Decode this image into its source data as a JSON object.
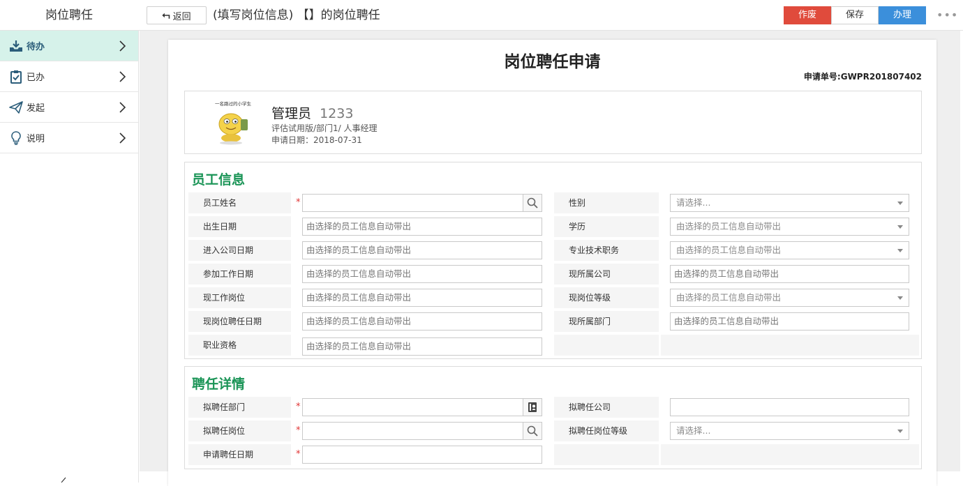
{
  "app": {
    "title": "岗位聘任"
  },
  "header": {
    "back_label": "返回",
    "heading": "(填写岗位信息) 【】的岗位聘任",
    "actions": {
      "void": "作废",
      "save": "保存",
      "handle": "办理"
    },
    "more": "•••"
  },
  "sidebar": {
    "items": [
      {
        "label": "待办",
        "icon": "inbox-icon",
        "active": true
      },
      {
        "label": "已办",
        "icon": "clipboard-check-icon",
        "active": false
      },
      {
        "label": "发起",
        "icon": "paper-plane-icon",
        "active": false
      },
      {
        "label": "说明",
        "icon": "lightbulb-icon",
        "active": false
      }
    ]
  },
  "form": {
    "title": "岗位聘任申请",
    "apply_no": "申请单号:GWPR201807402",
    "applicant": {
      "avatar_caption": "一名路过的小学生",
      "name": "管理员",
      "id": "1233",
      "dept": "评估试用版/部门1/ 人事经理",
      "date": "申请日期：2018-07-31"
    },
    "employee_section": {
      "title": "员工信息",
      "fields": {
        "name": {
          "label": "员工姓名",
          "value": ""
        },
        "gender": {
          "label": "性别",
          "placeholder": "请选择..."
        },
        "birth": {
          "label": "出生日期",
          "placeholder": "由选择的员工信息自动带出"
        },
        "education": {
          "label": "学历",
          "placeholder": "由选择的员工信息自动带出"
        },
        "join_date": {
          "label": "进入公司日期",
          "placeholder": "由选择的员工信息自动带出"
        },
        "tech_title": {
          "label": "专业技术职务",
          "placeholder": "由选择的员工信息自动带出"
        },
        "work_start": {
          "label": "参加工作日期",
          "placeholder": "由选择的员工信息自动带出"
        },
        "company": {
          "label": "现所属公司",
          "placeholder": "由选择的员工信息自动带出"
        },
        "position": {
          "label": "现工作岗位",
          "placeholder": "由选择的员工信息自动带出"
        },
        "level": {
          "label": "现岗位等级",
          "placeholder": "由选择的员工信息自动带出"
        },
        "hire_date": {
          "label": "现岗位聘任日期",
          "placeholder": "由选择的员工信息自动带出"
        },
        "dept": {
          "label": "现所属部门",
          "placeholder": "由选择的员工信息自动带出"
        },
        "qualification": {
          "label": "职业资格",
          "placeholder": "由选择的员工信息自动带出"
        }
      }
    },
    "hire_section": {
      "title": "聘任详情",
      "fields": {
        "target_dept": {
          "label": "拟聘任部门",
          "value": ""
        },
        "target_company": {
          "label": "拟聘任公司",
          "value": ""
        },
        "target_position": {
          "label": "拟聘任岗位",
          "value": ""
        },
        "target_level": {
          "label": "拟聘任岗位等级",
          "placeholder": "请选择..."
        },
        "apply_date": {
          "label": "申请聘任日期",
          "value": ""
        }
      }
    },
    "required_mark": "*"
  },
  "colors": {
    "accent_green": "#1a9456",
    "void_red": "#e04b3c",
    "handle_blue": "#3b8fdb",
    "sidebar_active": "#d6f2ea"
  }
}
